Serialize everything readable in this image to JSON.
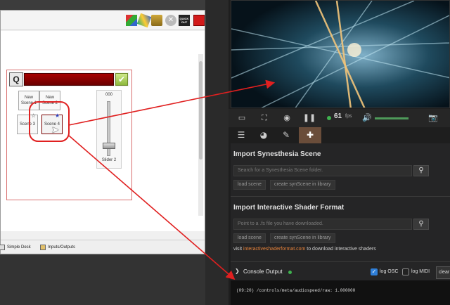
{
  "qlc_window": {
    "toolbar_icons": [
      "color-picker-icon",
      "palette-icon",
      "font-icon",
      "disable-icon",
      "quick-out-icon",
      "stop-all-icon"
    ],
    "quick_out_label": "QUICK\nOUT",
    "frame": {
      "logo_letter": "Q",
      "check_mark": "✔",
      "scenes": [
        {
          "label": "New Scene 1"
        },
        {
          "label": "New Scene 2"
        },
        {
          "label": "Scene 3"
        },
        {
          "label": "Scene 4"
        }
      ],
      "slider": {
        "value_text": "000",
        "label": "Slider 2",
        "level": 0
      }
    },
    "bottom_tabs": [
      {
        "label": "Simple Desk"
      },
      {
        "label": "Inputs/Outputs"
      }
    ]
  },
  "synesthesia": {
    "controls": {
      "fps_value": "61",
      "fps_unit": "fps",
      "volume_level": 0.95
    },
    "tabs": [
      {
        "icon": "list-icon"
      },
      {
        "icon": "palette-icon"
      },
      {
        "icon": "pencil-icon"
      },
      {
        "icon": "plus-icon",
        "active": true
      }
    ],
    "import_scene": {
      "title": "Import Synesthesia Scene",
      "search_placeholder": "Search for a Synesthesia Scene folder.",
      "load_label": "load scene",
      "create_label": "create synScene in library"
    },
    "import_isf": {
      "title": "Import Interactive Shader Format",
      "path_placeholder": "Point to a .fs file you have downloaded.",
      "load_label": "load scene",
      "create_label": "create synScene in library",
      "note_prefix": "visit ",
      "note_link": "interactiveshaderformat.com",
      "note_suffix": " to download interactive shaders"
    },
    "console": {
      "title": "Console Output",
      "log_osc_label": "log OSC",
      "log_osc_checked": true,
      "log_midi_label": "log MIDI",
      "log_midi_checked": false,
      "clear_label": "clear",
      "log_line": "(09:20) /controls/meta/audiospeed/raw: 1.000000"
    }
  },
  "colors": {
    "annotation_red": "#e02020",
    "accent_orange": "#e8833a",
    "active_tab": "#6a4d3a",
    "status_green": "#3fb24f"
  }
}
